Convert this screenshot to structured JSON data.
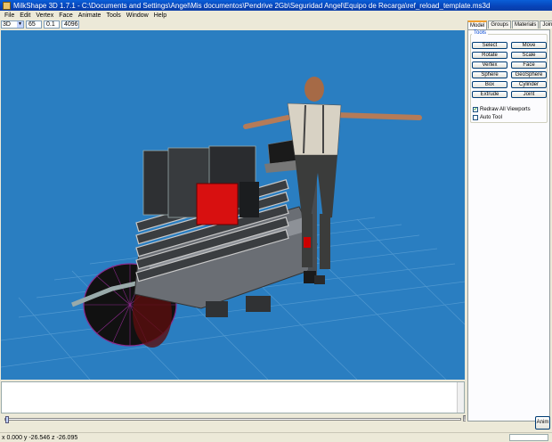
{
  "window": {
    "title": "MilkShape 3D 1.7.1 - C:\\Documents and Settings\\Angel\\Mis documentos\\Pendrive 2Gb\\Seguridad Angel\\Equipo de Recarga\\ref_reload_template.ms3d"
  },
  "menu": [
    "File",
    "Edit",
    "Vertex",
    "Face",
    "Animate",
    "Tools",
    "Window",
    "Help"
  ],
  "toolbar": {
    "view_mode": "3D",
    "field1": "65",
    "field2": "0.1",
    "field3": "4096"
  },
  "panel": {
    "tabs": [
      "Model",
      "Groups",
      "Materials",
      "Joints"
    ],
    "active_tab": "Model",
    "group_label": "Tools",
    "buttons": [
      [
        "Select",
        "Move"
      ],
      [
        "Rotate",
        "Scale"
      ],
      [
        "Vertex",
        "Face"
      ],
      [
        "Sphere",
        "GeoSphere"
      ],
      [
        "Box",
        "Cylinder"
      ],
      [
        "Extrude",
        "Joint"
      ]
    ],
    "redraw_all_viewports": "Redraw All Viewports",
    "auto_tool": "Auto Tool",
    "anim_button": "Anim"
  },
  "status": {
    "coords": "x 0.000 y -26.546 z -26.095"
  },
  "colors": {
    "viewport_bg": "#2a7ec1",
    "grid": "#5a9fd4"
  }
}
